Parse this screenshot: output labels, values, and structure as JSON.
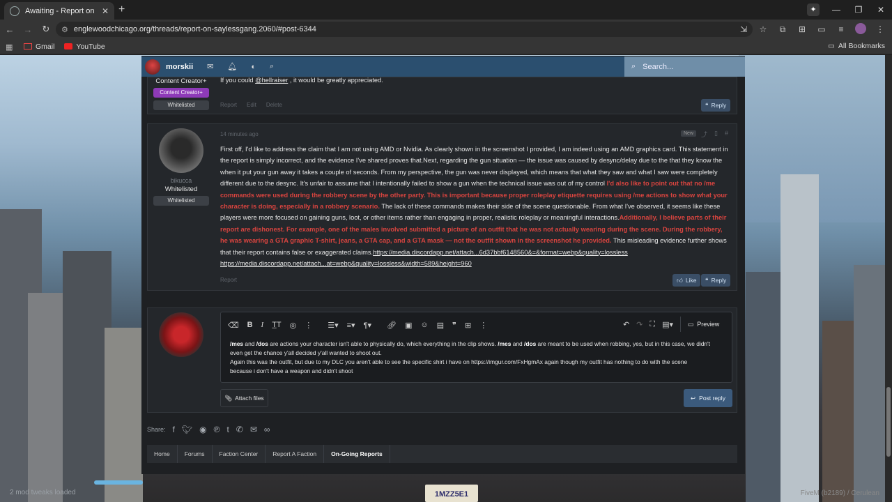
{
  "browser": {
    "tab_title": "Awaiting - Report on Saylessgang",
    "url": "englewoodchicago.org/threads/report-on-saylessgang.2060/#post-6344",
    "bookmarks": [
      {
        "label": "Gmail",
        "icon": "gmail-icon"
      },
      {
        "label": "YouTube",
        "icon": "youtube-icon"
      }
    ],
    "all_bookmarks": "All Bookmarks"
  },
  "forum_nav": {
    "username": "morskii",
    "search_placeholder": "Search..."
  },
  "post1": {
    "rank": "Content Creator+",
    "badge_creator": "Content Creator+",
    "badge_whitelisted": "Whitelisted",
    "text_prefix": "If you could ",
    "mention": "@hellraiser",
    "text_suffix": " , it would be greatly appreciated.",
    "actions": [
      "Report",
      "Edit",
      "Delete"
    ],
    "reply_label": "Reply"
  },
  "post2": {
    "time": "14 minutes ago",
    "new_tag": "New",
    "username": "bikucca",
    "rank": "Whitelisted",
    "badge": "Whitelisted",
    "p1": "First off, I'd like to address the claim that I am not using AMD or Nvidia. As clearly shown in the screenshot I provided, I am indeed using an AMD graphics card. This statement in the report is simply incorrect, and the evidence I've shared proves that.Next, regarding the gun situation — the issue was caused by desync/delay due to the that they know the when it put your gun away it takes a couple of seconds. From my perspective, the gun was never displayed, which means that what they saw and what I saw were completely different due to the desync. It's unfair to assume that I intentionally failed to show a gun when the technical issue was out of my control ",
    "red1": "I'd also like to point out that no /me commands were used during the robbery scene by the other party. This is important because proper roleplay etiquette requires using /me actions to show what your character is doing, especially in a robbery scenario.",
    "p2": " The lack of these commands makes their side of the scene questionable. From what I've observed, it seems like these players were more focused on gaining guns, loot, or other items rather than engaging in proper, realistic roleplay or meaningful interactions.",
    "red2": "Additionally, I believe parts of their report are dishonest. For example, one of the males involved submitted a picture of an outfit that he was not actually wearing during the scene. During the robbery, he was wearing a GTA graphic T-shirt, jeans, a GTA cap, and a GTA mask — not the outfit shown in the screenshot he provided.",
    "p3": " This misleading evidence further shows that their report contains false or exaggerated claims.",
    "link1": "https://media.discordapp.net/attach...6d37bbf6148560&=&format=webp&quality=lossless",
    "link2": "https://media.discordapp.net/attach...at=webp&quality=lossless&width=589&height=960",
    "report": "Report",
    "like_label": "Like",
    "reply_label": "Reply"
  },
  "editor": {
    "preview_label": "Preview",
    "line1_b1": "/mes",
    "line1_t1": " and ",
    "line1_b2": "/dos",
    "line1_t2": " are actions your character isn't able to physically do, which everything in the clip shows. ",
    "line1_b3": "/mes",
    "line1_t3": " and ",
    "line1_b4": "/dos",
    "line1_t4": " are meant to be used when robbing, yes, but in this case, we didn't even get the chance y'all decided y'all wanted to shoot out.",
    "line2": "Again this was the outfit, but due to my DLC you aren't able to see the specific shirt i have on  https://imgur.com/FxHgmAx again though my outfit has nothing to do with the scene because i don't have a weapon and didn't shoot",
    "attach_label": "Attach files",
    "post_reply_label": "Post reply"
  },
  "share_label": "Share:",
  "breadcrumbs": [
    "Home",
    "Forums",
    "Faction Center",
    "Report A Faction",
    "On-Going Reports"
  ],
  "hud": {
    "left_text": "2 mod tweaks loaded",
    "plate": "1MZZ5E1",
    "right_text": "FiveM (b2189) / Cerulean"
  },
  "colors": {
    "nav_blue": "#2b4f6f",
    "red_text": "#d9443f",
    "badge_purple": "#8e3ab8",
    "button_blue": "#3b5a7c"
  }
}
